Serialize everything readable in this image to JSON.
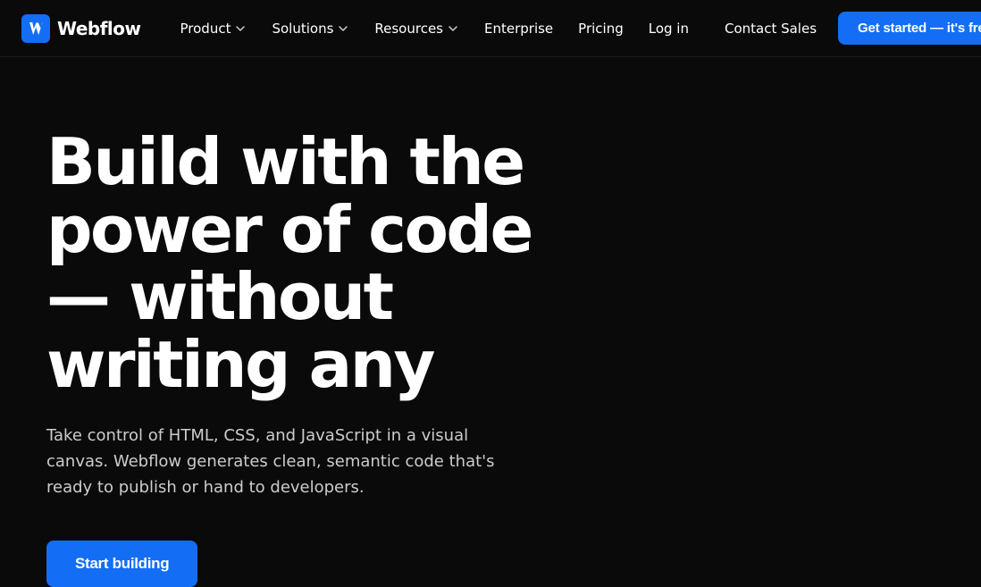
{
  "nav": {
    "logo_text": "Webflow",
    "links": [
      {
        "label": "Product",
        "has_chevron": true
      },
      {
        "label": "Solutions",
        "has_chevron": true
      },
      {
        "label": "Resources",
        "has_chevron": true
      },
      {
        "label": "Enterprise",
        "has_chevron": false
      },
      {
        "label": "Pricing",
        "has_chevron": false
      }
    ],
    "login_label": "Log in",
    "contact_label": "Contact Sales",
    "cta_label": "Get started — it's free"
  },
  "hero": {
    "title": "Build with the power of code — without writing any",
    "subtitle": "Take control of HTML, CSS, and JavaScript in a visual canvas. Webflow generates clean, semantic code that's ready to publish or hand to developers.",
    "cta_label": "Start building"
  },
  "colors": {
    "accent": "#146ef5",
    "background": "#0a0a0a",
    "text_primary": "#ffffff",
    "text_secondary": "#cccccc"
  }
}
